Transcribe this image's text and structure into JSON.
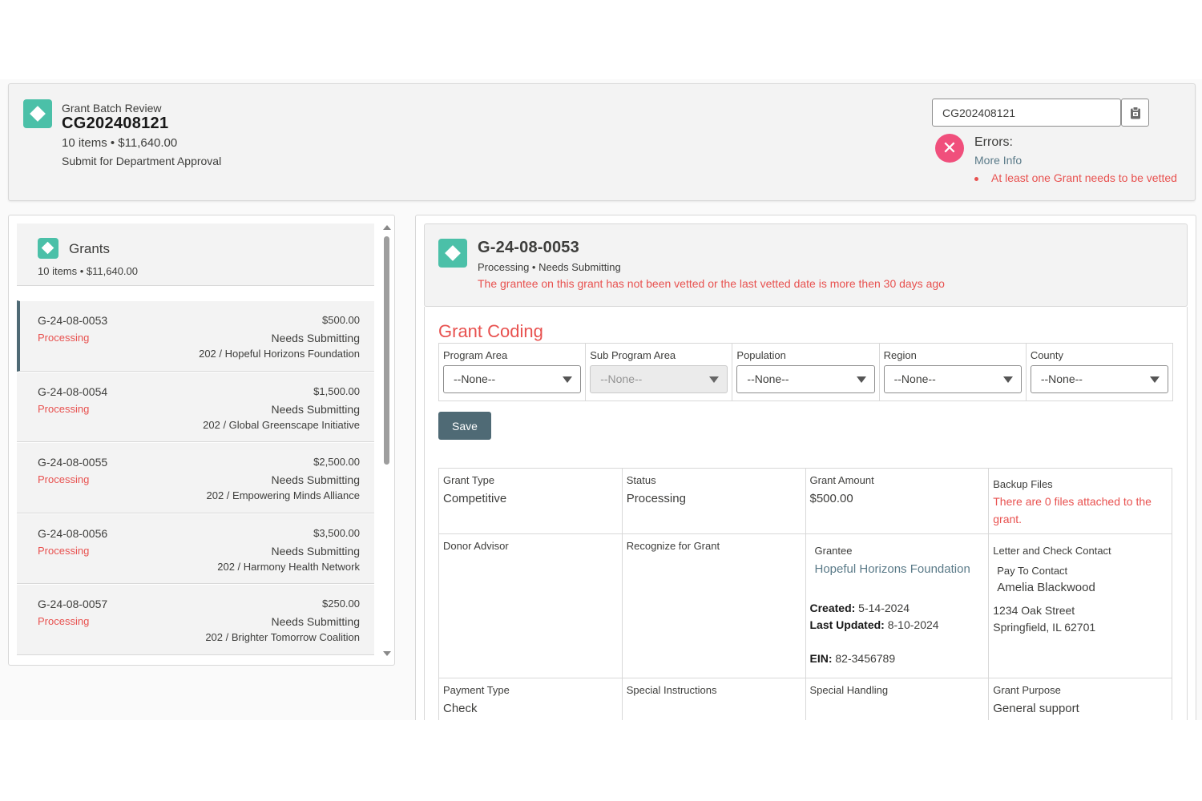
{
  "header": {
    "label": "Grant Batch Review",
    "title": "CG202408121",
    "summary": "10 items • $11,640.00",
    "action": "Submit for Department Approval",
    "search_value": "CG202408121",
    "errors_title": "Errors:",
    "more_info": "More Info",
    "error_item": "At least one Grant needs to be vetted"
  },
  "grants": {
    "title": "Grants",
    "summary": "10 items • $11,640.00",
    "items": [
      {
        "id": "G-24-08-0053",
        "status": "Processing",
        "amount": "$500.00",
        "sub_status": "Needs Submitting",
        "org": "202 / Hopeful Horizons Foundation"
      },
      {
        "id": "G-24-08-0054",
        "status": "Processing",
        "amount": "$1,500.00",
        "sub_status": "Needs Submitting",
        "org": "202 / Global Greenscape Initiative"
      },
      {
        "id": "G-24-08-0055",
        "status": "Processing",
        "amount": "$2,500.00",
        "sub_status": "Needs Submitting",
        "org": "202 / Empowering Minds Alliance"
      },
      {
        "id": "G-24-08-0056",
        "status": "Processing",
        "amount": "$3,500.00",
        "sub_status": "Needs Submitting",
        "org": "202 / Harmony Health Network"
      },
      {
        "id": "G-24-08-0057",
        "status": "Processing",
        "amount": "$250.00",
        "sub_status": "Needs Submitting",
        "org": "202 / Brighter Tomorrow Coalition"
      }
    ]
  },
  "detail": {
    "title": "G-24-08-0053",
    "subtitle": "Processing • Needs Submitting",
    "warning": "The grantee on this grant has not been vetted or the last vetted date is more then 30 days ago",
    "coding_title": "Grant Coding",
    "selects": [
      {
        "label": "Program Area",
        "value": "--None--"
      },
      {
        "label": "Sub Program Area",
        "value": "--None--"
      },
      {
        "label": "Population",
        "value": "--None--"
      },
      {
        "label": "Region",
        "value": "--None--"
      },
      {
        "label": "County",
        "value": "--None--"
      }
    ],
    "save_label": "Save",
    "fields": {
      "grant_type_label": "Grant Type",
      "grant_type": "Competitive",
      "status_label": "Status",
      "status": "Processing",
      "amount_label": "Grant Amount",
      "amount": "$500.00",
      "backup_label": "Backup Files",
      "backup_msg": "There are 0 files attached to the grant.",
      "donor_label": "Donor Advisor",
      "recognize_label": "Recognize for Grant",
      "grantee_label": "Grantee",
      "grantee": "Hopeful Horizons Foundation",
      "created_label": "Created:",
      "created": " 5-14-2024",
      "updated_label": "Last Updated:",
      "updated": " 8-10-2024",
      "ein_label": "EIN:",
      "ein": " 82-3456789",
      "contact_label": "Letter and Check Contact",
      "pay_to_label": "Pay To Contact",
      "pay_to": "Amelia Blackwood",
      "address1": "1234 Oak Street",
      "address2": "Springfield, IL 62701",
      "payment_type_label": "Payment Type",
      "payment_type": "Check",
      "special_instr_label": "Special Instructions",
      "special_handling_label": "Special Handling",
      "purpose_label": "Grant Purpose",
      "purpose": "General support"
    }
  },
  "colors": {
    "accent": "#4bc0a8",
    "error": "#e8514f",
    "button": "#4f6a75"
  }
}
